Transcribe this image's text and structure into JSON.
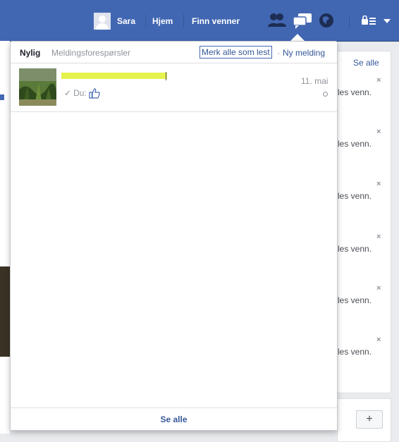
{
  "nav": {
    "user_name": "Sara",
    "home_label": "Hjem",
    "find_friends_label": "Finn venner"
  },
  "dropdown": {
    "tab_recent": "Nylig",
    "tab_requests": "Meldingsforespørsler",
    "mark_all_read": "Merk alle som lest",
    "separator": "·",
    "new_message": "Ny melding",
    "threads": [
      {
        "date": "11. mai",
        "preview_prefix": "Du:",
        "preview_icon": "thumbs-up-icon"
      }
    ],
    "footer_see_all": "Se alle"
  },
  "right_panel": {
    "see_all": "Se alle",
    "row_text": "les venn.",
    "close_glyph": "×",
    "rows": [
      "les venn.",
      "les venn.",
      "les venn.",
      "les venn.",
      "les venn.",
      "les venn."
    ],
    "add_button": "+"
  },
  "colors": {
    "brand_blue": "#4267b2",
    "link_blue": "#365899",
    "muted_gray": "#90949c",
    "redaction_yellow": "#e6f24e"
  }
}
